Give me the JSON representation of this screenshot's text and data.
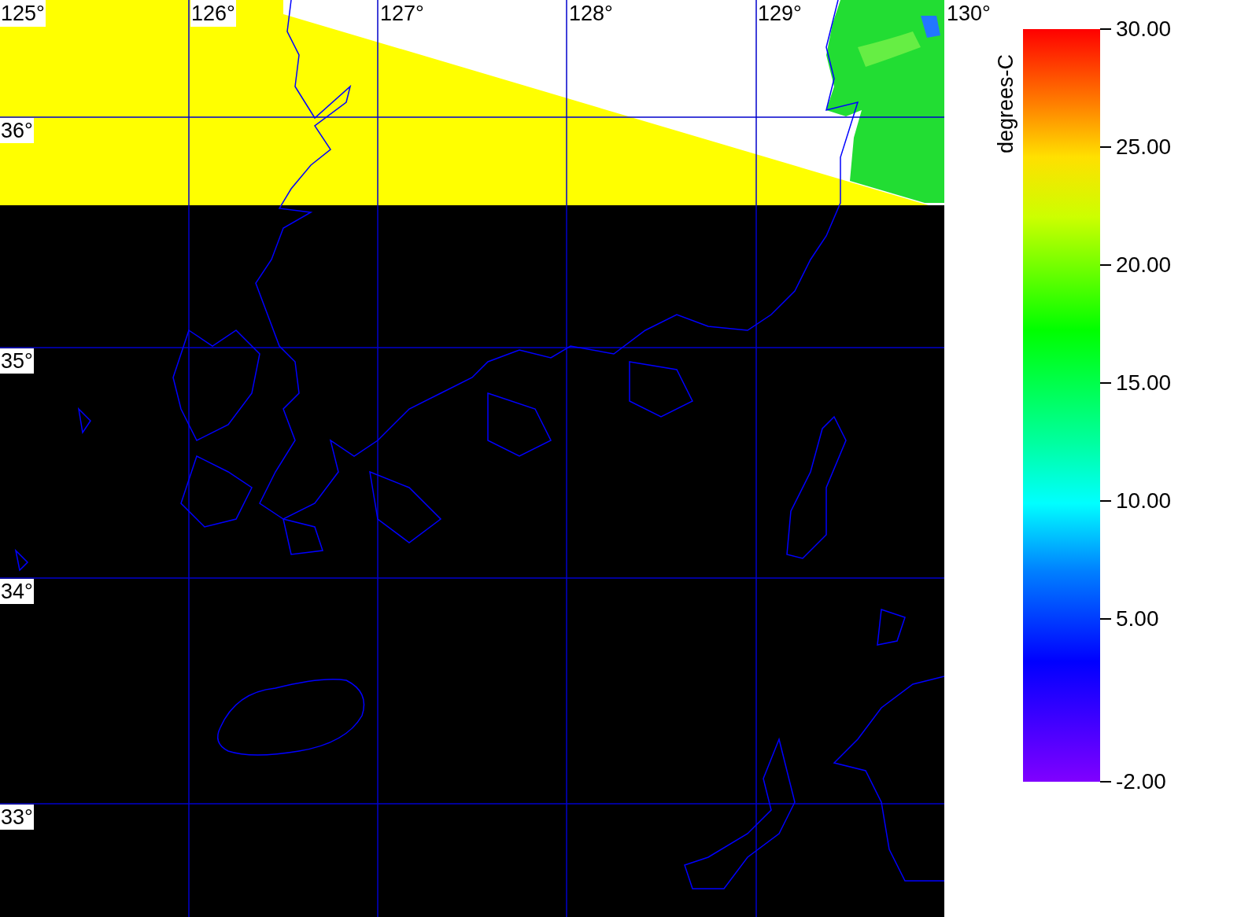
{
  "map": {
    "lon_labels": [
      "125°",
      "126°",
      "127°",
      "128°",
      "129°",
      "130°"
    ],
    "lat_labels": [
      "36°",
      "35°",
      "34°",
      "33°"
    ]
  },
  "colorbar": {
    "label": "degrees-C",
    "ticks": [
      "30.00",
      "25.00",
      "20.00",
      "15.00",
      "10.00",
      "5.00",
      "-2.00"
    ]
  }
}
